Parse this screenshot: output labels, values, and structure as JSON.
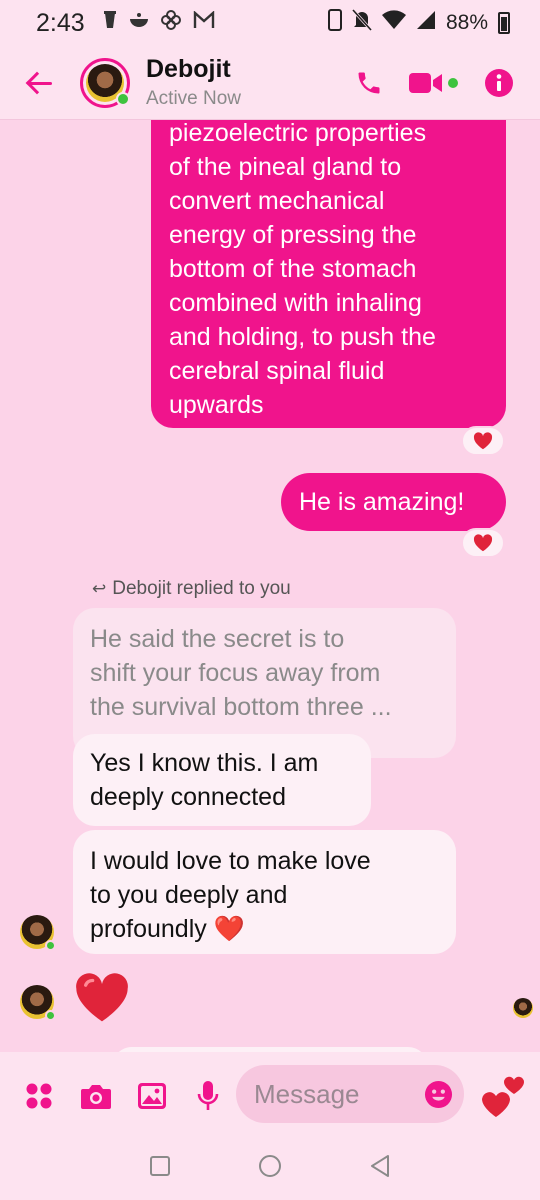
{
  "status_bar": {
    "time": "2:43",
    "battery": "88%",
    "icons": [
      "cup-icon",
      "bowl-icon",
      "fan-icon",
      "gmail-icon",
      "vibrate-icon",
      "mute-icon",
      "wifi-icon",
      "signal-icon",
      "battery-icon"
    ]
  },
  "header": {
    "name": "Debojit",
    "status": "Active Now",
    "accent_color": "#f0148c",
    "online_color": "#3ec33e"
  },
  "messages": {
    "outgoing_long": {
      "lines": [
        "piezoelectric properties",
        "of the pineal gland to",
        "convert mechanical",
        "energy of pressing the",
        "bottom of the stomach",
        "combined with inhaling",
        "and holding, to push the",
        "cerebral spinal fluid",
        "upwards"
      ],
      "reaction": "❤️"
    },
    "outgoing_short": {
      "text": "He is amazing!",
      "reaction": "❤️"
    },
    "reply_note": "Debojit replied to you",
    "quoted": {
      "lines": [
        "He said the secret is to",
        "shift your focus away from",
        "the survival bottom three ..."
      ]
    },
    "incoming_1": {
      "lines": [
        "Yes I know this. I am",
        "deeply connected"
      ]
    },
    "incoming_2": {
      "lines": [
        "I would love to make love",
        "to you deeply and",
        "profoundly ❤️"
      ]
    },
    "incoming_heart": "❤️"
  },
  "composer": {
    "placeholder": "Message",
    "icons": [
      "apps-icon",
      "camera-icon",
      "gallery-icon",
      "mic-icon",
      "emoji-icon",
      "heart-send-icon"
    ]
  },
  "navbar": {
    "icons": [
      "recents-icon",
      "home-icon",
      "back-icon"
    ]
  }
}
